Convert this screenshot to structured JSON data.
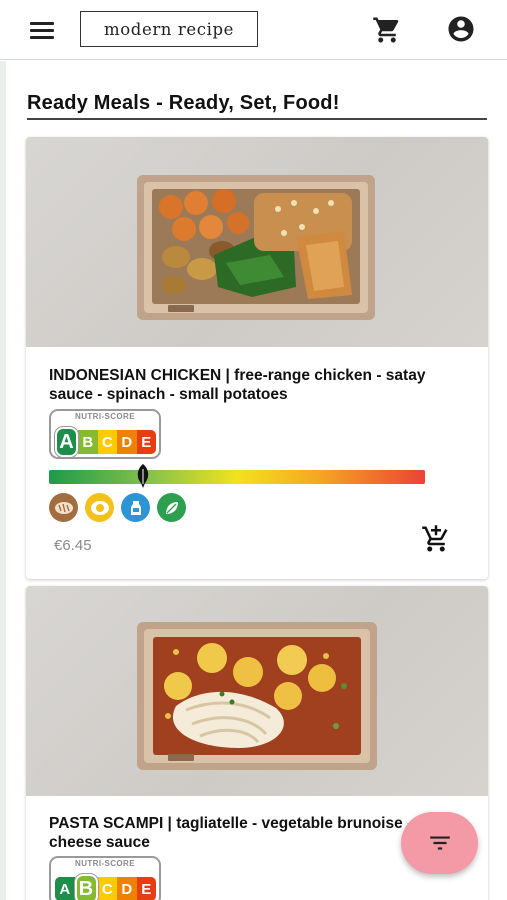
{
  "header": {
    "logo_text": "modern recipe",
    "menu_icon": "menu-icon",
    "cart_icon": "shopping-cart-icon",
    "account_icon": "account-circle-icon"
  },
  "page": {
    "heading": "Ready Meals - Ready, Set, Food!"
  },
  "nutri_score_caption": "NUTRI-SCORE",
  "nutri_grades": [
    "A",
    "B",
    "C",
    "D",
    "E"
  ],
  "nutri_colors": {
    "A": "#1e8f4b",
    "B": "#85bb2f",
    "C": "#fecb02",
    "D": "#ee8100",
    "E": "#e63e11"
  },
  "products": [
    {
      "title": "INDONESIAN CHICKEN | free-range chicken - satay sauce - spinach - small potatoes",
      "nutri_score": "A",
      "eco_score_fraction": 0.25,
      "diet_icons": [
        "bread-icon",
        "egg-icon",
        "dairy-icon",
        "leaf-icon"
      ],
      "price": "€6.45",
      "add_to_cart_icon": "add-to-cart-icon"
    },
    {
      "title": "PASTA SCAMPI | tagliatelle - vegetable brunoise - cheese sauce",
      "nutri_score": "B"
    }
  ],
  "fab": {
    "icon": "filter-icon"
  },
  "colors": {
    "fab": "#f49aa6",
    "diet_bread": "#a36e3f",
    "diet_egg": "#f3c21a",
    "diet_dairy": "#2b95d6",
    "diet_leaf": "#2e9e4f"
  }
}
